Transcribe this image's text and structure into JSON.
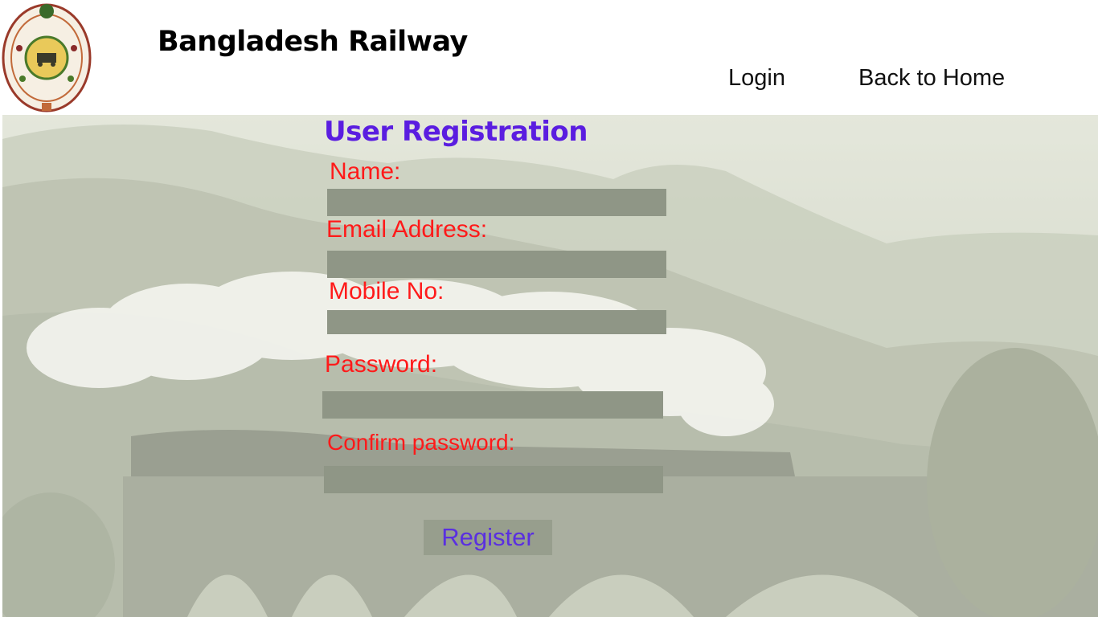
{
  "header": {
    "site_title": "Bangladesh Railway",
    "nav": {
      "login": "Login",
      "back_home": "Back to Home"
    },
    "logo_icon": "bangladesh-railway-emblem"
  },
  "form": {
    "title": "User Registration",
    "fields": [
      {
        "label": "Name:",
        "value": ""
      },
      {
        "label": "Email Address:",
        "value": ""
      },
      {
        "label": "Mobile No:",
        "value": ""
      },
      {
        "label": "Password:",
        "value": ""
      },
      {
        "label": "Confirm password:",
        "value": ""
      }
    ],
    "submit_label": "Register"
  },
  "colors": {
    "title": "#5a1de0",
    "label": "#ff1a1a",
    "field_bg": "#8f9686",
    "button_text": "#5a2fe0"
  }
}
